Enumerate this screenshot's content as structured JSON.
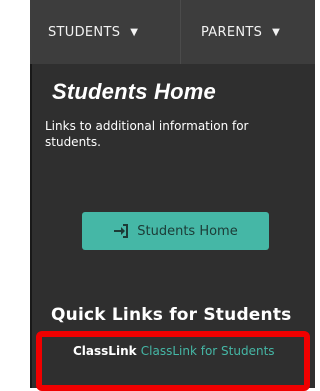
{
  "nav": {
    "students_label": "STUDENTS",
    "parents_label": "PARENTS",
    "caret_icon": "caret-down-icon"
  },
  "main": {
    "title": "Students Home",
    "description": "Links to additional information for students.",
    "home_button_label": "Students Home",
    "home_button_icon": "sign-in-icon",
    "quick_links_title": "Quick Links for Students",
    "quick_links": [
      {
        "label": "ClassLink",
        "link_text": "ClassLink for Students"
      }
    ]
  },
  "colors": {
    "nav_bg": "#3d3d3d",
    "panel_bg": "#2f2f2f",
    "accent": "#45b7a6",
    "highlight": "#f00000"
  }
}
